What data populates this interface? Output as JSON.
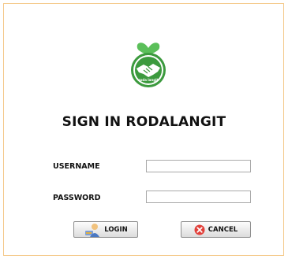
{
  "brand": {
    "logo_text": "roda langit",
    "logo_color": "#3c9a3e"
  },
  "title": "SIGN IN RODALANGIT",
  "form": {
    "username_label": "USERNAME",
    "password_label": "PASSWORD",
    "username_value": "",
    "password_value": ""
  },
  "buttons": {
    "login_label": "LOGIN",
    "login_icon": "user-key-icon",
    "cancel_label": "CANCEL",
    "cancel_icon": "cancel-x-icon"
  }
}
